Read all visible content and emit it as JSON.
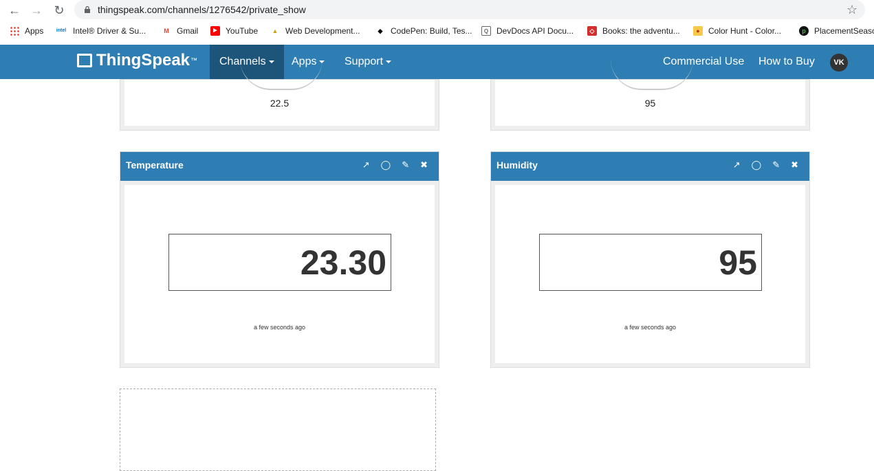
{
  "browser": {
    "url": "thingspeak.com/channels/1276542/private_show",
    "bookmarks": [
      {
        "label": "Apps",
        "icon": "apps-grid-icon"
      },
      {
        "label": "Intel® Driver & Su...",
        "icon": "intel-icon"
      },
      {
        "label": "Gmail",
        "icon": "gmail-icon"
      },
      {
        "label": "YouTube",
        "icon": "youtube-icon"
      },
      {
        "label": "Web Development...",
        "icon": "web-dev-icon"
      },
      {
        "label": "CodePen: Build, Tes...",
        "icon": "codepen-icon"
      },
      {
        "label": "DevDocs API Docu...",
        "icon": "devdocs-icon"
      },
      {
        "label": "Books: the adventu...",
        "icon": "books-icon"
      },
      {
        "label": "Color Hunt - Color...",
        "icon": "colorhunt-icon"
      },
      {
        "label": "PlacementSeaso",
        "icon": "placement-icon"
      }
    ]
  },
  "nav": {
    "brand": "ThingSpeak",
    "brand_tm": "™",
    "channels": "Channels",
    "apps": "Apps",
    "support": "Support",
    "commercial": "Commercial Use",
    "how_to_buy": "How to Buy",
    "avatar": "VK"
  },
  "gauges": [
    {
      "value": "22.5"
    },
    {
      "value": "95"
    }
  ],
  "widgets": [
    {
      "title": "Temperature",
      "value": "23.30",
      "timestamp": "a few seconds ago"
    },
    {
      "title": "Humidity",
      "value": "95",
      "timestamp": "a few seconds ago"
    }
  ],
  "colors": {
    "nav_bg": "#2e7eb4",
    "nav_active": "#1d5479"
  }
}
